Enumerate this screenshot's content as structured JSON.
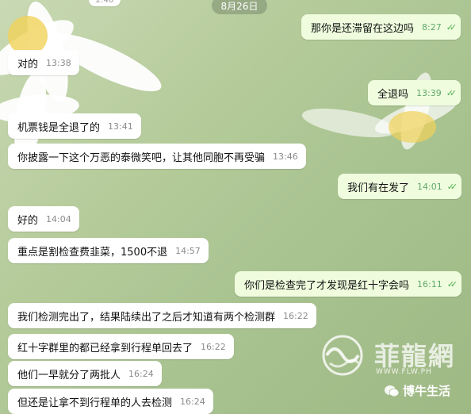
{
  "top_partial_time": "2:40",
  "date_pill": "8月26日",
  "messages": [
    {
      "dir": "out",
      "text": "那你是还滞留在这边吗",
      "time": "8:27"
    },
    {
      "dir": "in",
      "text": "对的",
      "time": "13:38"
    },
    {
      "dir": "out",
      "text": "全退吗",
      "time": "13:39"
    },
    {
      "dir": "in",
      "text": "机票钱是全退了的",
      "time": "13:41"
    },
    {
      "dir": "in",
      "text": "你披露一下这个万恶的泰微笑吧，让其他同胞不再受骗",
      "time": "13:46"
    },
    {
      "dir": "out",
      "text": "我们有在发了",
      "time": "14:01"
    },
    {
      "dir": "in",
      "text": "好的",
      "time": "14:04"
    },
    {
      "dir": "in",
      "text": "重点是割检查费韭菜，1500不退",
      "time": "14:57"
    },
    {
      "dir": "out",
      "text": "你们是检查完了才发现是红十字会吗",
      "time": "16:11"
    },
    {
      "dir": "in",
      "text": "我们检测完出了，结果陆续出了之后才知道有两个检测群",
      "time": "16:22"
    },
    {
      "dir": "in",
      "text": "红十字群里的都已经拿到行程单回去了",
      "time": "16:22"
    },
    {
      "dir": "in",
      "text": "他们一早就分了两批人",
      "time": "16:24"
    },
    {
      "dir": "in",
      "text": "但还是让拿不到行程单的人去检测",
      "time": "16:24"
    }
  ],
  "watermark": {
    "brand": "菲龍網",
    "url": "WWW.FLW.PH",
    "account": "博牛生活"
  },
  "icons": {
    "read_ticks": "double-check-icon",
    "logo": "dragon-logo-icon",
    "account": "wechat-account-icon"
  }
}
